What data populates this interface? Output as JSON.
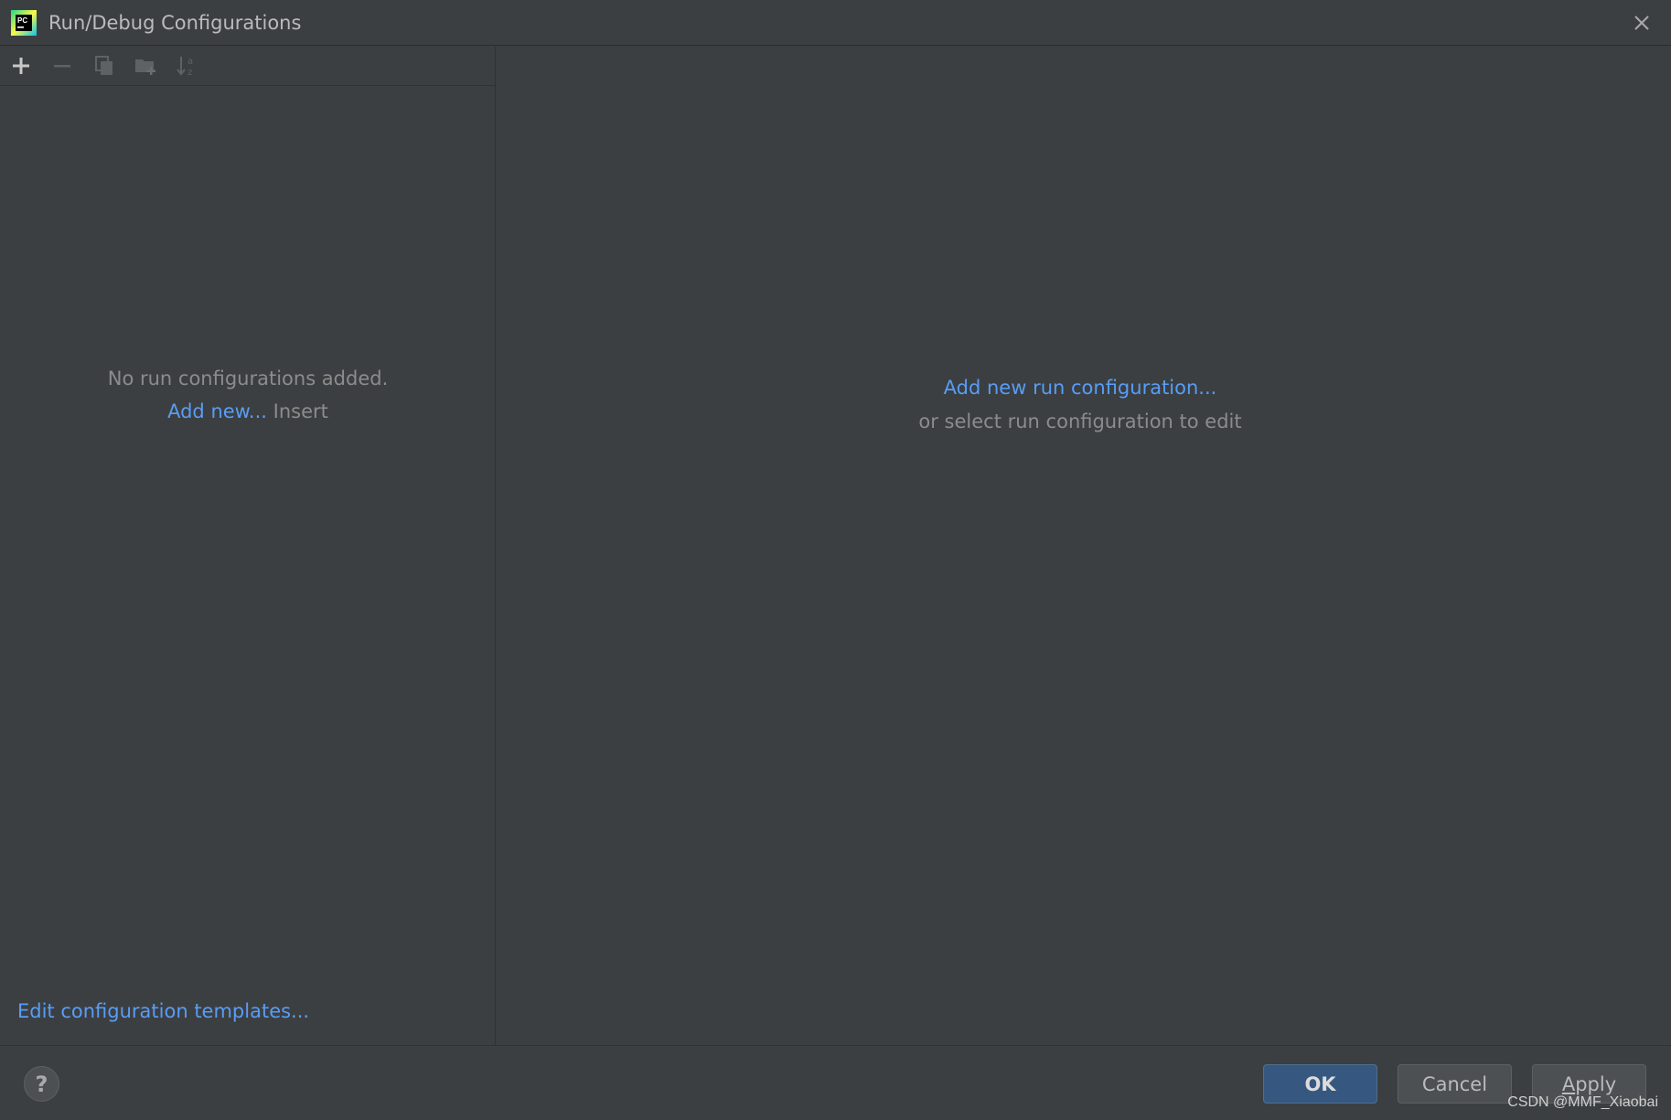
{
  "window": {
    "title": "Run/Debug Configurations",
    "app_icon": "pycharm-icon",
    "close_icon": "close-icon"
  },
  "toolbar": {
    "buttons": [
      {
        "icon": "add-icon",
        "enabled": true
      },
      {
        "icon": "remove-icon",
        "enabled": false
      },
      {
        "icon": "copy-icon",
        "enabled": false
      },
      {
        "icon": "new-folder-icon",
        "enabled": false
      },
      {
        "icon": "sort-alpha-icon",
        "enabled": false
      }
    ]
  },
  "left_panel": {
    "empty_text": "No run configurations added.",
    "add_new_link": "Add new...",
    "add_new_shortcut": "Insert",
    "templates_link": "Edit configuration templates..."
  },
  "right_panel": {
    "add_link": "Add new run configuration...",
    "sub_text": "or select run configuration to edit"
  },
  "footer": {
    "help_label": "?",
    "ok_label": "OK",
    "cancel_label": "Cancel",
    "apply_mnemonic": "A",
    "apply_rest": "pply"
  },
  "watermark": "CSDN @MMF_Xiaobai",
  "colors": {
    "background": "#3c3f41",
    "link": "#589df6",
    "muted_text": "#8c8c8c",
    "primary_button": "#365880"
  }
}
